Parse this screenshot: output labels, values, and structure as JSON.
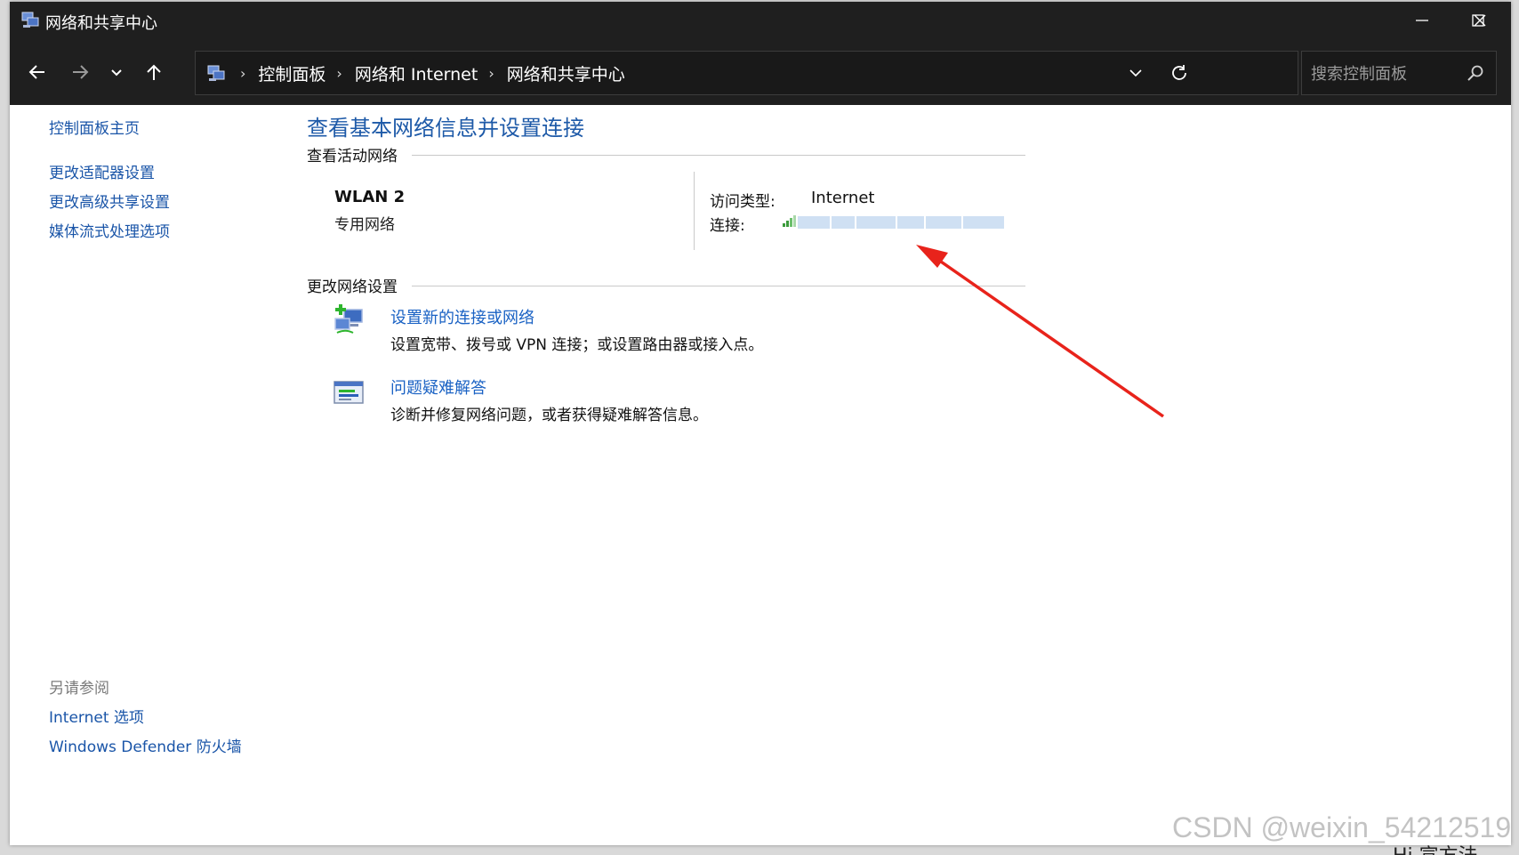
{
  "window": {
    "title": "网络和共享中心",
    "controls": {
      "minimize": "minimize-icon",
      "maximize": "maximize-icon",
      "close": "close-icon"
    }
  },
  "nav": {
    "breadcrumb": [
      "控制面板",
      "网络和 Internet",
      "网络和共享中心"
    ],
    "search_placeholder": "搜索控制面板"
  },
  "sidebar": {
    "home_link": "控制面板主页",
    "links": [
      "更改适配器设置",
      "更改高级共享设置",
      "媒体流式处理选项"
    ],
    "see_also_heading": "另请参阅",
    "see_also_links": [
      "Internet 选项",
      "Windows Defender 防火墙"
    ]
  },
  "main": {
    "title": "查看基本网络信息并设置连接",
    "active_heading": "查看活动网络",
    "network_name": "WLAN 2",
    "network_type": "专用网络",
    "access_type_label": "访问类型:",
    "access_type_value": "Internet",
    "connection_label": "连接:",
    "change_heading": "更改网络设置",
    "tasks": [
      {
        "title": "设置新的连接或网络",
        "desc": "设置宽带、拨号或 VPN 连接；或设置路由器或接入点。"
      },
      {
        "title": "问题疑难解答",
        "desc": "诊断并修复网络问题，或者获得疑难解答信息。"
      }
    ]
  },
  "watermark": "CSDN @weixin_54212519",
  "corner_text": "Hi  宣方法",
  "colors": {
    "link": "#1a55a8",
    "title": "#1e5aa8",
    "titlebar": "#1f1f1f",
    "arrow": "#e8231b"
  }
}
